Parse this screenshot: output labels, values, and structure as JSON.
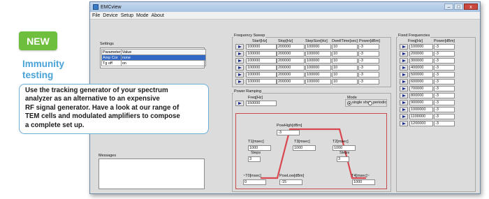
{
  "promo": {
    "badge": "NEW",
    "headline_line1": "Immunity",
    "headline_line2": "testing",
    "body_lines": [
      "Use the tracking generator of your spectrum",
      "analyzer as an alternative to an expensive",
      "RF signal generator. Have a look at our range of",
      "TEM cells and modulated amplifiers to compose",
      "a complete set up."
    ]
  },
  "window": {
    "title": "EMCview",
    "controls": [
      "–",
      "□",
      "x"
    ],
    "menu": [
      "File",
      "Device",
      "Setup",
      "Mode",
      "About"
    ]
  },
  "settings": {
    "label": "Settings",
    "headers": [
      "Parameter",
      "Value"
    ],
    "rows": [
      [
        "Amp Cor",
        "none"
      ],
      [
        "Tg off",
        "on"
      ]
    ]
  },
  "messages": {
    "label": "Messages"
  },
  "frequency_sweep": {
    "label": "Frequency Sweep",
    "headers": [
      "Start[Hz]",
      "Stop[Hz]",
      "StepSize[Hz]",
      "DwellTime[sec]",
      "Power[dBm]"
    ],
    "rows": [
      [
        "100000",
        "200000",
        "100000",
        "10",
        "-3"
      ],
      [
        "100000",
        "200000",
        "100000",
        "10",
        "-3"
      ],
      [
        "100000",
        "200000",
        "100000",
        "10",
        "-3"
      ],
      [
        "100000",
        "200000",
        "100000",
        "10",
        "-3"
      ],
      [
        "100000",
        "200000",
        "100000",
        "10",
        "-3"
      ],
      [
        "100000",
        "200000",
        "100000",
        "10",
        "-3"
      ]
    ]
  },
  "fixed_frequencies": {
    "label": "Fixed Frequencies",
    "headers": [
      "Freq[Hz]",
      "Power[dBm]"
    ],
    "rows": [
      [
        "100000",
        "-3"
      ],
      [
        "200000",
        "-3"
      ],
      [
        "300000",
        "-3"
      ],
      [
        "400000",
        "-3"
      ],
      [
        "500000",
        "-3"
      ],
      [
        "600000",
        "-3"
      ],
      [
        "700000",
        "-3"
      ],
      [
        "800000",
        "-3"
      ],
      [
        "900000",
        "-3"
      ],
      [
        "1000000",
        "-3"
      ],
      [
        "1100000",
        "-3"
      ],
      [
        "1200000",
        "-3"
      ]
    ]
  },
  "power_ramping": {
    "label": "Power Ramping",
    "freq_label": "Freq[Hz]",
    "freq_value": "150000",
    "mode_label": "Mode",
    "mode_options": [
      "single shot",
      "periodic"
    ],
    "mode_selected": "single shot",
    "pow_high_label": "PowHigh[dBm]",
    "pow_high_value": "-3",
    "t1_label": "T1[msec]",
    "t1_value": "1000",
    "t3_label": "T3[msec]",
    "t3_value": "1000",
    "t2_label": "T2[msec]",
    "t2_value": "1000",
    "steps_left_label": "Steps",
    "steps_left_value": "3",
    "steps_right_label": "Steps",
    "steps_right_value": "3",
    "t0_label": "~T0[msec]",
    "t0_value": "0",
    "pow_low_label": "PowLow[dBm]",
    "pow_low_value": "-15",
    "t4_label": "T4[msec]~",
    "t4_value": "1000",
    "line_color": "#d9484f"
  }
}
